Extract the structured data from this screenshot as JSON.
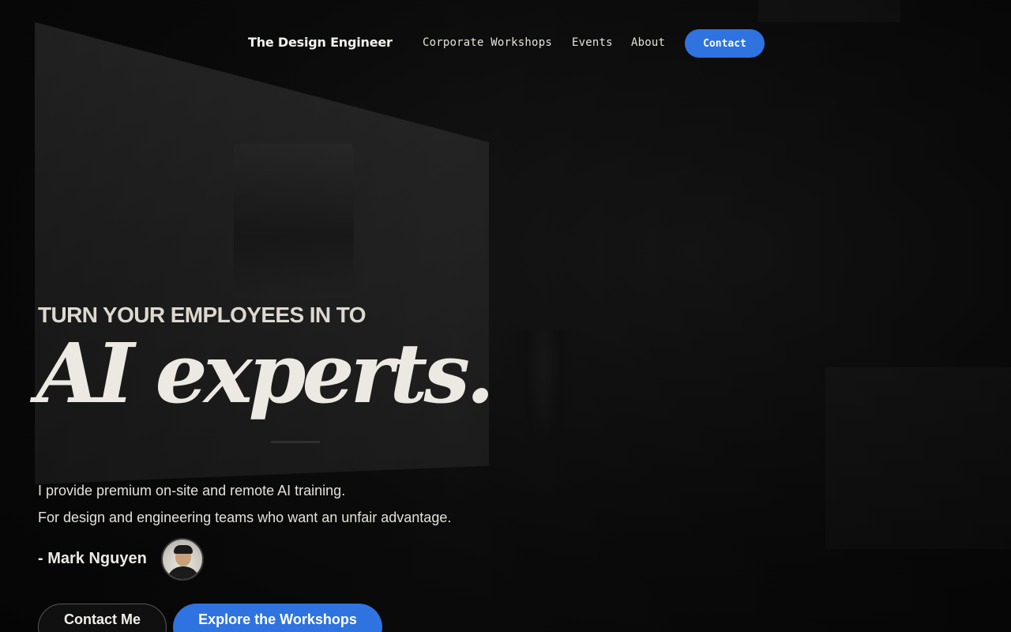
{
  "header": {
    "brand": "The Design Engineer",
    "nav": [
      "Corporate Workshops",
      "Events",
      "About"
    ],
    "contact_label": "Contact"
  },
  "hero": {
    "kicker": "TURN YOUR EMPLOYEES IN TO",
    "headline": "AI experts.",
    "lede": "I provide premium on-site and remote AI training.",
    "sublede": "For design and engineering teams who want an unfair advantage.",
    "signature": "- Mark Nguyen",
    "cta_secondary": "Contact Me",
    "cta_primary": "Explore the Workshops"
  },
  "colors": {
    "accent": "#2f73e0",
    "background": "#0a0a0a",
    "text": "#ece9e2"
  }
}
